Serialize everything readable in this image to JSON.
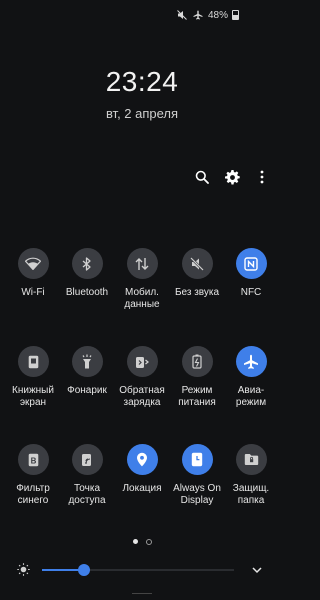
{
  "status_bar": {
    "battery": "48%",
    "icons": [
      "mute-icon",
      "airplane-icon",
      "battery-icon"
    ]
  },
  "lock": {
    "time": "23:24",
    "date": "вт, 2 апреля"
  },
  "top_actions": [
    "search-icon",
    "gear-icon",
    "more-icon"
  ],
  "tiles": [
    [
      {
        "id": "wifi",
        "label": "Wi-Fi",
        "icon": "wifi-icon",
        "active": false
      },
      {
        "id": "bluetooth",
        "label": "Bluetooth",
        "icon": "bluetooth-icon",
        "active": false
      },
      {
        "id": "mobile-data",
        "label": "Мобил.\nданные",
        "icon": "mobile-data-icon",
        "active": false
      },
      {
        "id": "silent",
        "label": "Без звука",
        "icon": "mute-icon",
        "active": false
      },
      {
        "id": "nfc",
        "label": "NFC",
        "icon": "nfc-icon",
        "active": true
      }
    ],
    [
      {
        "id": "book-screen",
        "label": "Книжный\nэкран",
        "icon": "book-icon",
        "active": false
      },
      {
        "id": "flashlight",
        "label": "Фонарик",
        "icon": "flashlight-icon",
        "active": false
      },
      {
        "id": "reverse-charge",
        "label": "Обратная\nзарядка",
        "icon": "reverse-charge-icon",
        "active": false
      },
      {
        "id": "power-mode",
        "label": "Режим\nпитания",
        "icon": "battery-mode-icon",
        "active": false
      },
      {
        "id": "airplane",
        "label": "Авиа-\nрежим",
        "icon": "airplane-icon",
        "active": true
      }
    ],
    [
      {
        "id": "blue-filter",
        "label": "Фильтр\nсинего",
        "icon": "blue-filter-icon",
        "active": false
      },
      {
        "id": "hotspot",
        "label": "Точка\nдоступа",
        "icon": "hotspot-icon",
        "active": false
      },
      {
        "id": "location",
        "label": "Локация",
        "icon": "location-icon",
        "active": true
      },
      {
        "id": "aod",
        "label": "Always On\nDisplay",
        "icon": "clock-icon",
        "active": true
      },
      {
        "id": "secure-folder",
        "label": "Защищ.\nпапка",
        "icon": "secure-folder-icon",
        "active": false
      }
    ]
  ],
  "pager": {
    "pages": 2,
    "current": 1
  },
  "brightness": {
    "level": 0.22
  },
  "colors": {
    "accent": "#3f7fe9",
    "tile_off": "#3b3d42",
    "background": "#111214"
  }
}
